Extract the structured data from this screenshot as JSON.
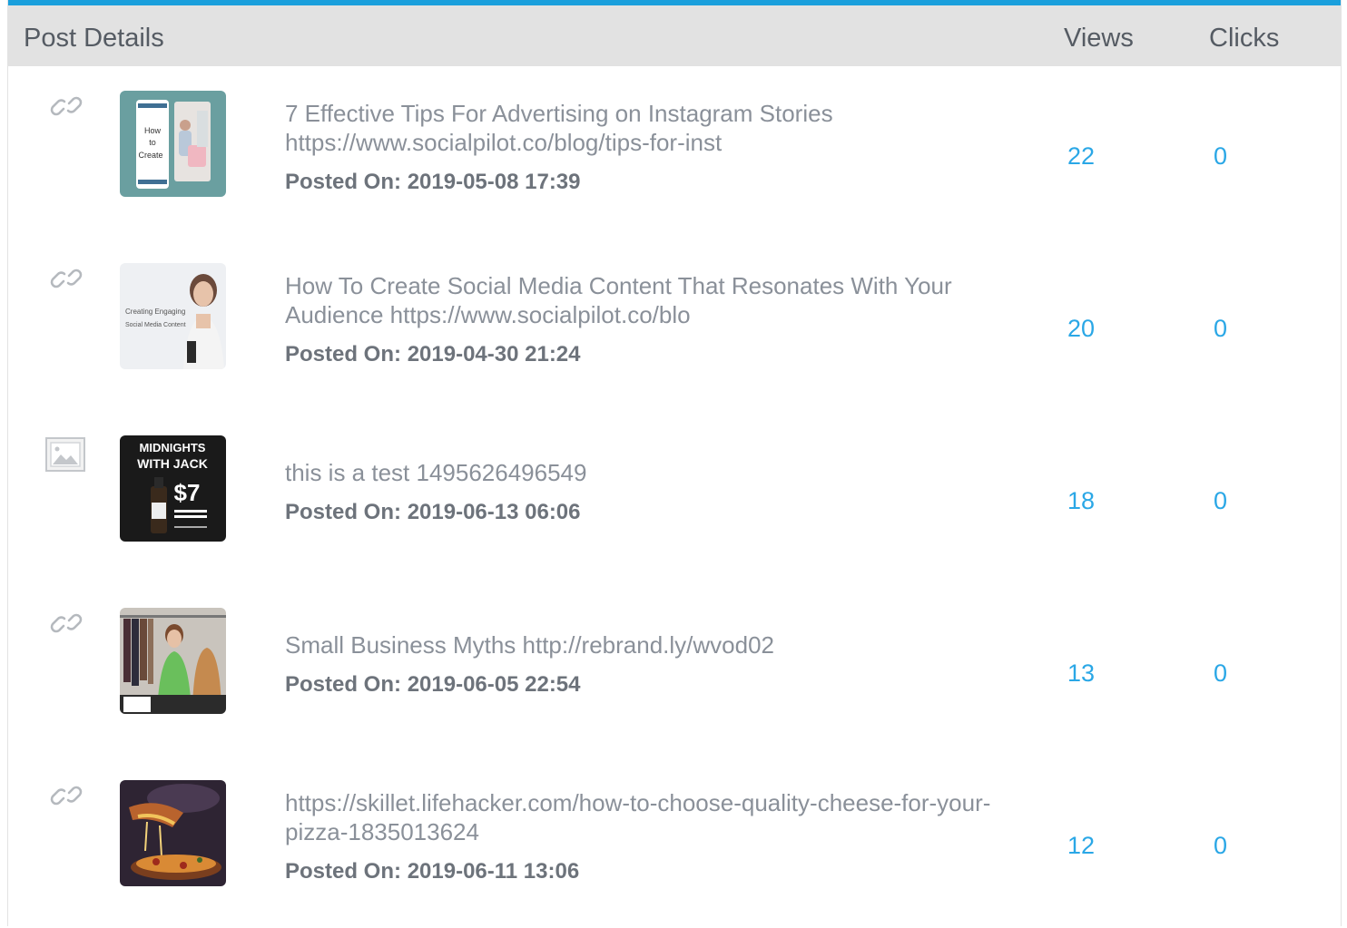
{
  "header": {
    "details_label": "Post Details",
    "views_label": "Views",
    "clicks_label": "Clicks"
  },
  "colors": {
    "accent": "#1a9fdc",
    "header_bg": "#e2e2e2",
    "number": "#2aa7e6"
  },
  "posts": [
    {
      "type_icon": "link-icon",
      "thumbnail": "instagram-stories-thumbnail",
      "title": "7 Effective Tips For Advertising on Instagram Stories https://www.socialpilot.co/blog/tips-for-inst",
      "posted_label": "Posted On:",
      "posted_on": "2019-05-08 17:39",
      "views": "22",
      "clicks": "0"
    },
    {
      "type_icon": "link-icon",
      "thumbnail": "social-media-content-thumbnail",
      "title": "How To Create Social Media Content That Resonates With Your Audience https://www.socialpilot.co/blo",
      "posted_label": "Posted On:",
      "posted_on": "2019-04-30 21:24",
      "views": "20",
      "clicks": "0"
    },
    {
      "type_icon": "image-icon",
      "thumbnail": "midnights-with-jack-thumbnail",
      "title": "this is a test 1495626496549",
      "posted_label": "Posted On:",
      "posted_on": "2019-06-13 06:06",
      "views": "18",
      "clicks": "0"
    },
    {
      "type_icon": "link-icon",
      "thumbnail": "small-business-myths-thumbnail",
      "title": "Small Business Myths http://rebrand.ly/wvod02",
      "posted_label": "Posted On:",
      "posted_on": "2019-06-05 22:54",
      "views": "13",
      "clicks": "0"
    },
    {
      "type_icon": "link-icon",
      "thumbnail": "pizza-cheese-thumbnail",
      "title": "https://skillet.lifehacker.com/how-to-choose-quality-cheese-for-your-pizza-1835013624",
      "posted_label": "Posted On:",
      "posted_on": "2019-06-11 13:06",
      "views": "12",
      "clicks": "0"
    }
  ],
  "thumb_text": {
    "t1_a": "How",
    "t1_b": "to",
    "t1_c": "Create",
    "t2_a": "Creating Engaging",
    "t2_b": "Social Media Content",
    "t3_a": "MIDNIGHTS",
    "t3_b": "WITH JACK",
    "t3_c": "$7"
  }
}
